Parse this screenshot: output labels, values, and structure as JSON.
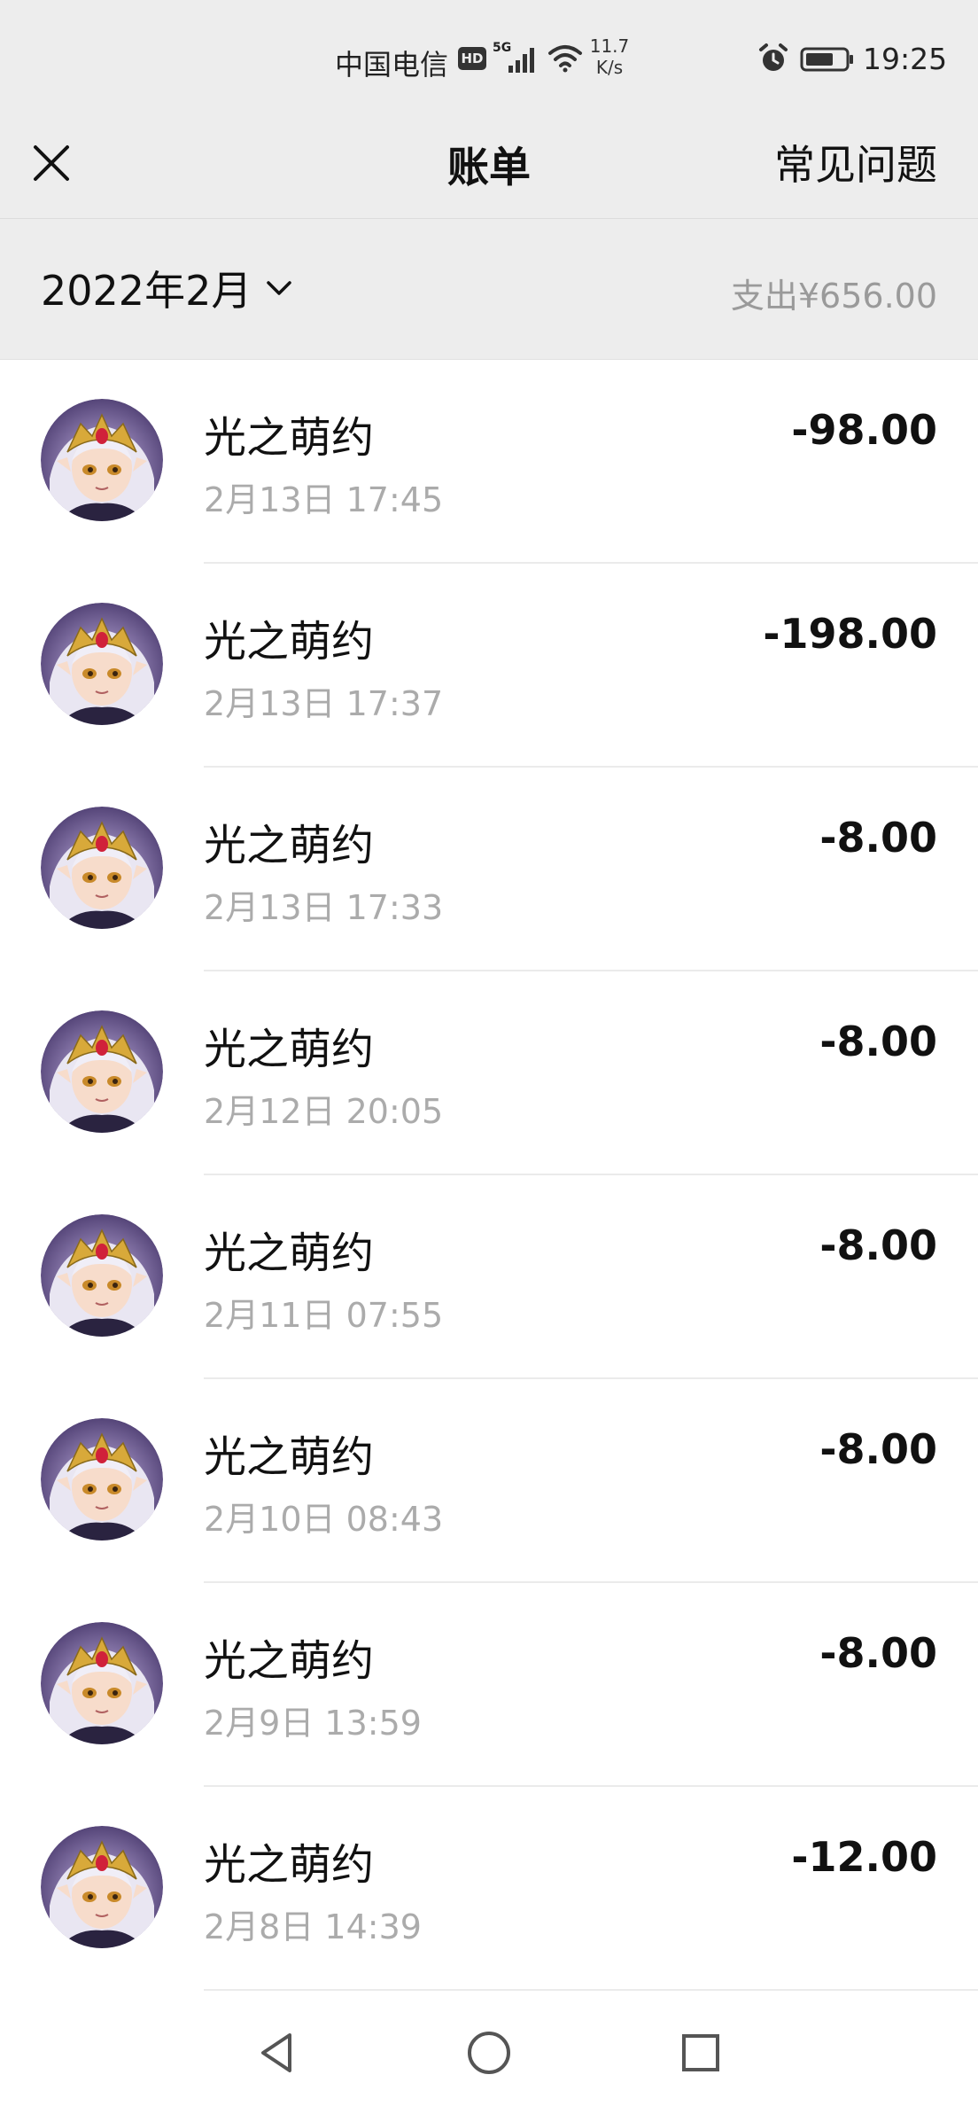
{
  "status_bar": {
    "carrier": "中国电信",
    "hd": "HD",
    "network": "5G",
    "speed_value": "11.7",
    "speed_unit": "K/s",
    "time": "19:25"
  },
  "header": {
    "title": "账单",
    "faq_label": "常见问题"
  },
  "month_bar": {
    "month": "2022年2月",
    "expense_summary": "支出¥656.00"
  },
  "transactions": [
    {
      "name": "光之萌约",
      "time": "2月13日 17:45",
      "amount": "-98.00"
    },
    {
      "name": "光之萌约",
      "time": "2月13日 17:37",
      "amount": "-198.00"
    },
    {
      "name": "光之萌约",
      "time": "2月13日 17:33",
      "amount": "-8.00"
    },
    {
      "name": "光之萌约",
      "time": "2月12日 20:05",
      "amount": "-8.00"
    },
    {
      "name": "光之萌约",
      "time": "2月11日 07:55",
      "amount": "-8.00"
    },
    {
      "name": "光之萌约",
      "time": "2月10日 08:43",
      "amount": "-8.00"
    },
    {
      "name": "光之萌约",
      "time": "2月9日 13:59",
      "amount": "-8.00"
    },
    {
      "name": "光之萌约",
      "time": "2月8日 14:39",
      "amount": "-12.00"
    }
  ],
  "nav_bar": {
    "back_icon": "triangle-back-icon",
    "home_icon": "circle-home-icon",
    "recent_icon": "square-recent-icon"
  },
  "colors": {
    "header_bg": "#ededed",
    "secondary_text": "#ababab",
    "summary_text": "#9a9a9a"
  }
}
